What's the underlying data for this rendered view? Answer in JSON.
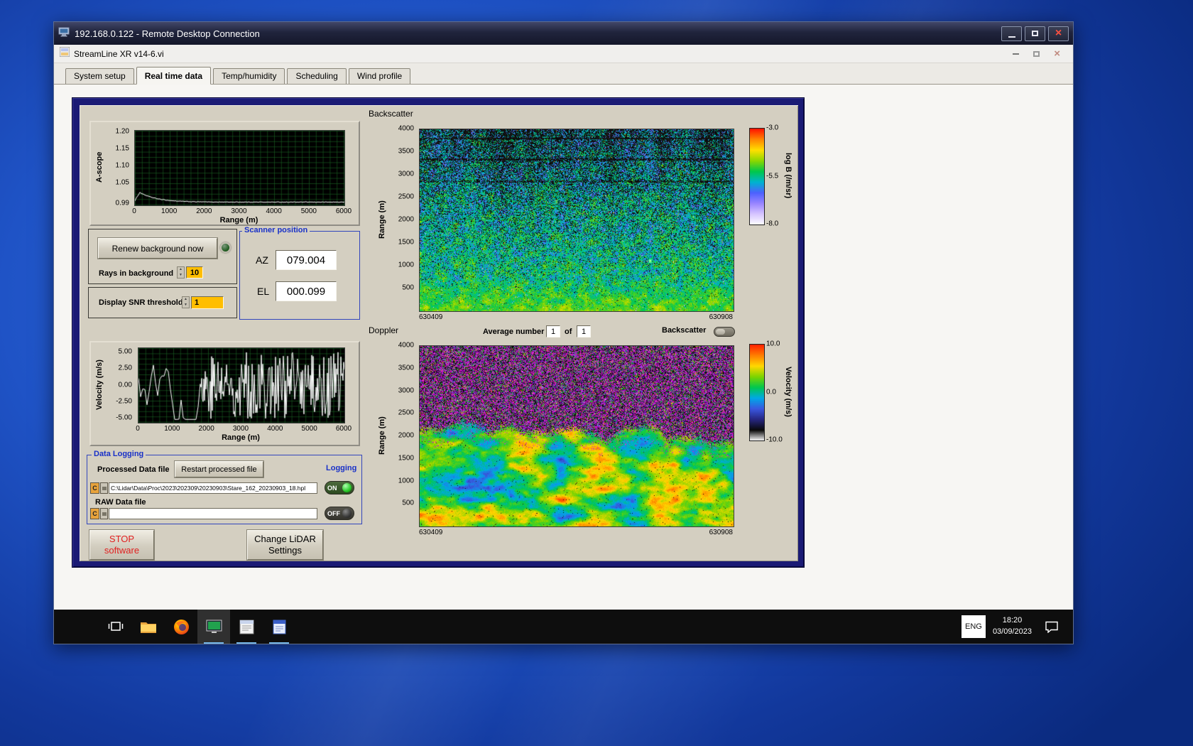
{
  "rdp": {
    "title": "192.168.0.122 - Remote Desktop Connection"
  },
  "app": {
    "title": "StreamLine XR v14-6.vi",
    "tabs": [
      "System setup",
      "Real time data",
      "Temp/humidity",
      "Scheduling",
      "Wind profile"
    ],
    "active_tab": "Real time data"
  },
  "panel": {
    "renew_button": "Renew background now",
    "rays_label": "Rays in background",
    "rays_value": "10",
    "snr_label": "Display SNR threshold",
    "snr_value": "1",
    "scanner": {
      "title": "Scanner position",
      "az_label": "AZ",
      "az_value": "079.004",
      "el_label": "EL",
      "el_value": "000.099"
    },
    "average": {
      "label": "Average number",
      "value1": "1",
      "of": "of",
      "value2": "1",
      "toggle_label": "Backscatter"
    },
    "logging": {
      "title": "Data Logging",
      "processed_label": "Processed Data file",
      "restart_button": "Restart processed file",
      "logging_label": "Logging",
      "drive_icon": "C",
      "processed_path": "C:\\Lidar\\Data\\Proc\\2023\\202309\\20230903\\Stare_162_20230903_18.hpl",
      "on_label": "ON",
      "raw_label": "RAW Data file",
      "raw_path": "",
      "off_label": "OFF"
    },
    "stop_button_line1": "STOP",
    "stop_button_line2": "software",
    "change_button_line1": "Change LiDAR",
    "change_button_line2": "Settings"
  },
  "taskbar": {
    "language": "ENG",
    "time": "18:20",
    "date": "03/09/2023",
    "icons": [
      "task-view",
      "file-explorer",
      "firefox",
      "streamline-app",
      "scan-scheduler",
      "notes-app",
      "notification"
    ]
  },
  "colors": {
    "desktop_blue": "#1f53c6",
    "panel_navy": "#1b1b75",
    "panel_beige": "#d4cfc1",
    "accent_yellow": "#ffbe00",
    "group_blue": "#3246bc",
    "led_on_green": "#28c828"
  },
  "chart_data": [
    {
      "id": "ascope",
      "type": "line",
      "ylabel": "A-scope",
      "xlabel": "Range (m)",
      "ytick_labels": [
        "1.20",
        "1.15",
        "1.10",
        "1.05",
        "0.99"
      ],
      "yticks": [
        1.2,
        1.15,
        1.1,
        1.05,
        0.99
      ],
      "xtick_labels": [
        "0",
        "1000",
        "2000",
        "3000",
        "4000",
        "5000",
        "6000"
      ],
      "xticks": [
        0,
        1000,
        2000,
        3000,
        4000,
        5000,
        6000
      ],
      "xlim": [
        0,
        6000
      ],
      "ylim": [
        0.985,
        1.205
      ],
      "grid": true,
      "legend_position": "none",
      "line_color": "#ffffff",
      "bg_color": "#000000",
      "grid_color": "#1e6e28",
      "series": [
        {
          "name": "A-scope intensity",
          "summary": "peak ~1.025 near range 120 m decaying to flat ~0.995 out to 6000 m with small noise"
        }
      ]
    },
    {
      "id": "backscatter",
      "type": "heatmap",
      "title": "Backscatter",
      "ylabel": "Range (m)",
      "ytick_labels": [
        "4000",
        "3500",
        "3000",
        "2500",
        "2000",
        "1500",
        "1000",
        "500"
      ],
      "yticks": [
        4000,
        3500,
        3000,
        2500,
        2000,
        1500,
        1000,
        500
      ],
      "ylim": [
        0,
        4000
      ],
      "x_start_label": "630409",
      "x_end_label": "630908",
      "colorbar": {
        "label": "log B (/m/sr)",
        "ticks": [
          "-3.0",
          "-5.5",
          "-8.0"
        ],
        "tick_values": [
          -3.0,
          -5.5,
          -8.0
        ],
        "range": [
          -8.0,
          -3.0
        ],
        "stops": [
          "#ffffff",
          "#d8c6ff",
          "#9a86ff",
          "#4e62ff",
          "#00b4d0",
          "#00c84c",
          "#8cd800",
          "#ffe000",
          "#ff8800",
          "#ff1400"
        ]
      },
      "summary": "speckled aerosol backscatter field around -5.5 log B; heavier black dropout speckle aloft, bright continuous green layer near the surface"
    },
    {
      "id": "velocity",
      "type": "line",
      "ylabel": "Velocity (m/s)",
      "xlabel": "Range (m)",
      "ytick_labels": [
        "5.00",
        "2.50",
        "0.00",
        "-2.50",
        "-5.00"
      ],
      "yticks": [
        5.0,
        2.5,
        0.0,
        -2.5,
        -5.0
      ],
      "xtick_labels": [
        "0",
        "1000",
        "2000",
        "3000",
        "4000",
        "5000",
        "6000"
      ],
      "xticks": [
        0,
        1000,
        2000,
        3000,
        4000,
        5000,
        6000
      ],
      "xlim": [
        0,
        6000
      ],
      "ylim": [
        -5.6,
        5.6
      ],
      "grid": true,
      "legend_position": "none",
      "line_color": "#ffffff",
      "bg_color": "#000000",
      "grid_color": "#1e6e28",
      "series": [
        {
          "name": "radial velocity",
          "summary": "noisy trace spanning -5 to +5 m/s, increasingly saturated full-range noise beyond ~1800 m"
        }
      ]
    },
    {
      "id": "doppler",
      "type": "heatmap",
      "title": "Doppler",
      "ylabel": "Range (m)",
      "ytick_labels": [
        "4000",
        "3500",
        "3000",
        "2500",
        "2000",
        "1500",
        "1000",
        "500"
      ],
      "yticks": [
        4000,
        3500,
        3000,
        2500,
        2000,
        1500,
        1000,
        500
      ],
      "ylim": [
        0,
        4000
      ],
      "x_start_label": "630409",
      "x_end_label": "630908",
      "colorbar": {
        "label": "Velocity (m/s)",
        "ticks": [
          "10.0",
          "0.0",
          "-10.0"
        ],
        "tick_values": [
          10.0,
          0.0,
          -10.0
        ],
        "range": [
          -10.0,
          10.0
        ],
        "stops": [
          "#ffffff",
          "#0a0a0a",
          "#262680",
          "#3a58e0",
          "#00a8e8",
          "#00c850",
          "#7cd400",
          "#ffd800",
          "#ff8000",
          "#ff2400"
        ]
      },
      "summary": "magenta/black uncorrelated noise above ~1800 m; coherent green-yellow-orange velocity field (0 to +6 m/s) with blue downdraft patches below"
    }
  ]
}
